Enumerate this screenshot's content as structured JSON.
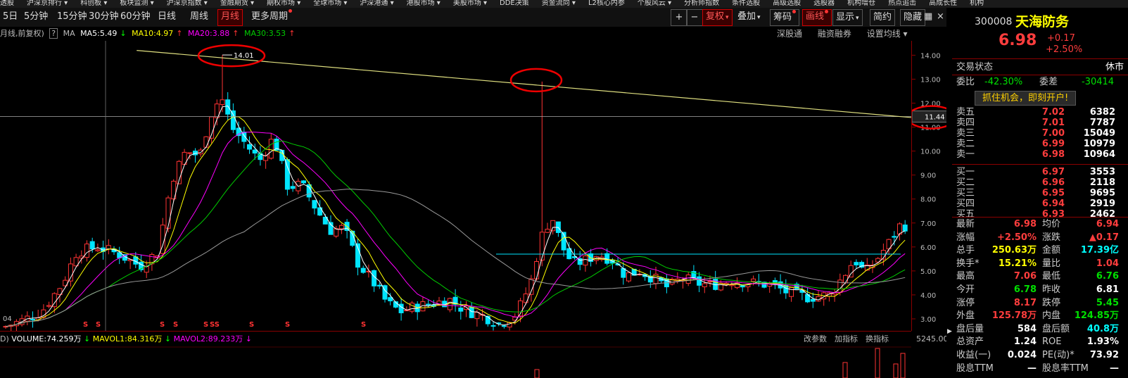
{
  "menu": [
    "透股",
    "沪深京排行 ▾",
    "科创板 ▾",
    "板块监测 ▾",
    "沪深京指数 ▾",
    "金融期货 ▾",
    "期权市场 ▾",
    "全球市场 ▾",
    "沪深港通 ▾",
    "港股市场 ▾",
    "美股市场 ▾",
    "DDE决策",
    "资金流向 ▾",
    "L2核心内参",
    "个股风云 ▾",
    "分析师指数",
    "条件选股",
    "高级选股",
    "选股器",
    "机构增仓",
    "热点追击",
    "高成长性",
    "机构"
  ],
  "toolbar": {
    "periods": [
      "5日",
      "5分钟",
      "15分钟",
      "30分钟",
      "60分钟",
      "日线",
      "周线",
      "月线",
      "更多周期"
    ],
    "selected": "月线",
    "right": {
      "plus": "+",
      "minus": "−",
      "fq": "复权",
      "add": "叠加",
      "chip": "筹码",
      "draw": "画线",
      "show": "显示",
      "simple": "简约",
      "hide": "隐藏",
      "grid": "▦",
      "close": "×"
    }
  },
  "indicator": {
    "prefix": "月线,前复权)",
    "help": "?",
    "ma_label": "MA",
    "ma5": "MA5:5.49",
    "ma10": "MA10:4.97",
    "ma20": "MA20:3.88",
    "ma30": "MA30:3.53",
    "arrow_down": "↓",
    "arrow_up": "↑",
    "links": [
      "深股通",
      "融资融券",
      "设置均线 ▾"
    ]
  },
  "chart_data": {
    "type": "candlestick",
    "y_ticks": [
      "14.00",
      "13.00",
      "12.00",
      "11.00",
      "10.00",
      "9.00",
      "8.00",
      "7.00",
      "6.00",
      "5.00",
      "4.00",
      "3.00"
    ],
    "ylim": [
      2.5,
      14.6
    ],
    "high_label": "14.01",
    "crosshair_label": "11.44",
    "crosshair_value": 11.44,
    "left_date": "04",
    "s_markers": [
      "S",
      "S",
      "S",
      "S",
      "S",
      "SS",
      "S",
      "S",
      "S"
    ],
    "trendline": [
      [
        0.15,
        14.2
      ],
      [
        1.0,
        11.4
      ]
    ],
    "hline": 5.7,
    "ma_colors": {
      "ma5": "#ffffff",
      "ma10": "#ffff00",
      "ma20": "#ff00ff",
      "ma30": "#00cc00",
      "long": "#999999"
    }
  },
  "volume_bar": {
    "prefix": "D)",
    "volume": "VOLUME:74.259万",
    "mavol1": "MAVOL1:84.316万",
    "mavol2": "MAVOL2:89.233万",
    "links": [
      "改参数",
      "加指标",
      "换指标"
    ],
    "axis_label": "5245.00"
  },
  "quote": {
    "code": "300008",
    "name": "天海防务",
    "price": "6.98",
    "change": "+0.17",
    "change_pct": "+2.50%",
    "status_label": "交易状态",
    "status": "休市",
    "webi_label": "委比",
    "webi": "-42.30%",
    "wecha_label": "委差",
    "wecha": "-30414",
    "banner": "抓住机会，即刻开户!",
    "asks": [
      {
        "label": "卖五",
        "price": "7.02",
        "vol": "6382"
      },
      {
        "label": "卖四",
        "price": "7.01",
        "vol": "7787"
      },
      {
        "label": "卖三",
        "price": "7.00",
        "vol": "15049"
      },
      {
        "label": "卖二",
        "price": "6.99",
        "vol": "10979"
      },
      {
        "label": "卖一",
        "price": "6.98",
        "vol": "10964"
      }
    ],
    "bids": [
      {
        "label": "买一",
        "price": "6.97",
        "vol": "3553"
      },
      {
        "label": "买二",
        "price": "6.96",
        "vol": "2118"
      },
      {
        "label": "买三",
        "price": "6.95",
        "vol": "9695"
      },
      {
        "label": "买四",
        "price": "6.94",
        "vol": "2919"
      },
      {
        "label": "买五",
        "price": "6.93",
        "vol": "2462"
      }
    ],
    "stats": [
      {
        "l1": "最新",
        "v1": "6.98",
        "c1": "red",
        "l2": "均价",
        "v2": "6.94",
        "c2": "red"
      },
      {
        "l1": "涨幅",
        "v1": "+2.50%",
        "c1": "red",
        "l2": "涨跌",
        "v2": "▲0.17",
        "c2": "red"
      },
      {
        "l1": "总手",
        "v1": "250.63万",
        "c1": "yel",
        "l2": "金额",
        "v2": "17.39亿",
        "c2": "cyn"
      },
      {
        "l1": "换手*",
        "v1": "15.21%",
        "c1": "yel",
        "l2": "量比",
        "v2": "1.04",
        "c2": "red"
      },
      {
        "l1": "最高",
        "v1": "7.06",
        "c1": "red",
        "l2": "最低",
        "v2": "6.76",
        "c2": "grn"
      },
      {
        "l1": "今开",
        "v1": "6.78",
        "c1": "grn",
        "l2": "昨收",
        "v2": "6.81",
        "c2": "wht"
      },
      {
        "l1": "涨停",
        "v1": "8.17",
        "c1": "red",
        "l2": "跌停",
        "v2": "5.45",
        "c2": "grn"
      },
      {
        "l1": "外盘",
        "v1": "125.78万",
        "c1": "red",
        "l2": "内盘",
        "v2": "124.85万",
        "c2": "grn"
      },
      {
        "l1": "盘后量",
        "v1": "584",
        "c1": "wht",
        "l2": "盘后额",
        "v2": "40.8万",
        "c2": "cyn"
      },
      {
        "l1": "总资产",
        "v1": "1.24",
        "c1": "wht",
        "l2": "ROE",
        "v2": "1.93%",
        "c2": "wht"
      },
      {
        "l1": "收益(一)",
        "v1": "0.024",
        "c1": "wht",
        "l2": "PE(动)*",
        "v2": "73.92",
        "c2": "wht"
      },
      {
        "l1": "股息TTM",
        "v1": "—",
        "c1": "wht",
        "l2": "股息率TTM",
        "v2": "—",
        "c2": "wht"
      }
    ]
  }
}
